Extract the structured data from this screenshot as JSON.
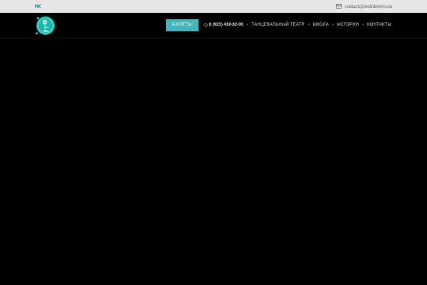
{
  "topbar": {
    "social_icon": "vk-icon",
    "contact_icon": "mail-icon",
    "email": "contact@teatrdetstva.ru"
  },
  "header": {
    "logo_icon": "flower-logo-icon",
    "tickets_label": "БИЛЕТЫ",
    "phone_icon": "phone-icon",
    "phone": "8 (921) 419-82-00",
    "separator": "•",
    "nav": [
      {
        "label": "ТАНЦЕВАЛЬНЫЙ ТЕАТР"
      },
      {
        "label": "ШКОЛА"
      },
      {
        "label": "ИСТОРИИ"
      },
      {
        "label": "КОНТАКТЫ"
      }
    ]
  },
  "colors": {
    "accent": "#45b3bc",
    "logo_teal": "#19b8ad",
    "topbar_bg": "#e9e7e5",
    "page_bg": "#000000"
  }
}
